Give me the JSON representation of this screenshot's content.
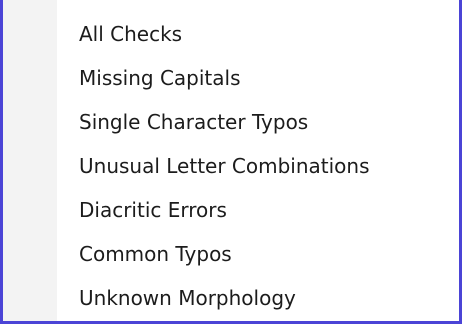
{
  "menu": {
    "items": [
      {
        "label": "All Checks"
      },
      {
        "label": "Missing Capitals"
      },
      {
        "label": "Single Character Typos"
      },
      {
        "label": "Unusual Letter Combinations"
      },
      {
        "label": "Diacritic Errors"
      },
      {
        "label": "Common Typos"
      },
      {
        "label": "Unknown Morphology"
      }
    ]
  },
  "colors": {
    "border": "#4b44d6",
    "gutter": "#f3f3f3",
    "text": "#1c1c1c",
    "background": "#ffffff"
  }
}
